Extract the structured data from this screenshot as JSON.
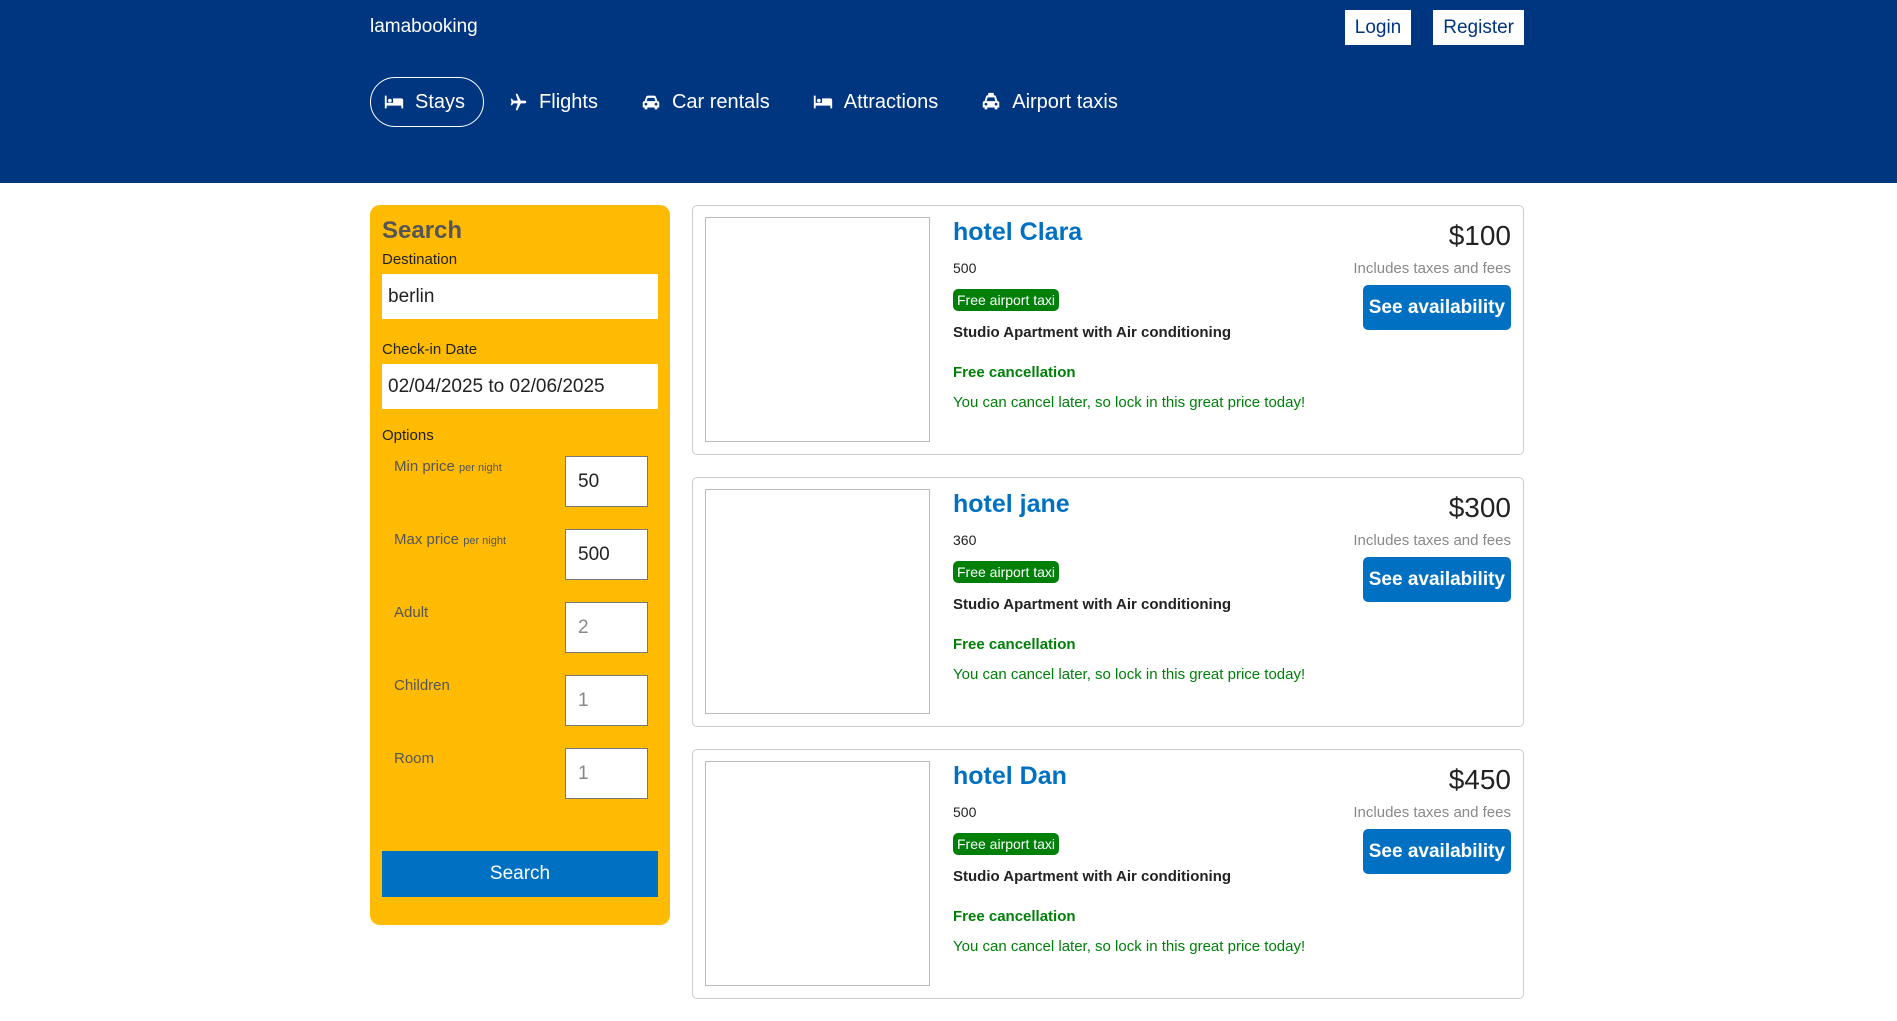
{
  "header": {
    "logo": "lamabooking",
    "login_label": "Login",
    "register_label": "Register",
    "tabs": [
      {
        "label": "Stays",
        "icon": "bed-icon",
        "active": true
      },
      {
        "label": "Flights",
        "icon": "plane-icon",
        "active": false
      },
      {
        "label": "Car rentals",
        "icon": "car-icon",
        "active": false
      },
      {
        "label": "Attractions",
        "icon": "bed-icon",
        "active": false
      },
      {
        "label": "Airport taxis",
        "icon": "taxi-icon",
        "active": false
      }
    ]
  },
  "search": {
    "title": "Search",
    "destination_label": "Destination",
    "destination_value": "berlin",
    "checkin_label": "Check-in Date",
    "checkin_value": "02/04/2025 to 02/06/2025",
    "options_label": "Options",
    "options": {
      "min_price": {
        "label": "Min price",
        "unit": "per night",
        "value": "50"
      },
      "max_price": {
        "label": "Max price",
        "unit": "per night",
        "value": "500"
      },
      "adult": {
        "label": "Adult",
        "placeholder": "2"
      },
      "children": {
        "label": "Children",
        "placeholder": "1"
      },
      "room": {
        "label": "Room",
        "placeholder": "1"
      }
    },
    "button_label": "Search"
  },
  "results": [
    {
      "name": "hotel Clara",
      "distance": "500",
      "taxi_badge": "Free airport taxi",
      "description": "Studio Apartment with Air conditioning",
      "cancel_title": "Free cancellation",
      "cancel_subtitle": "You can cancel later, so lock in this great price today!",
      "price": "$100",
      "tax_note": "Includes taxes and fees",
      "button_label": "See availability"
    },
    {
      "name": "hotel jane",
      "distance": "360",
      "taxi_badge": "Free airport taxi",
      "description": "Studio Apartment with Air conditioning",
      "cancel_title": "Free cancellation",
      "cancel_subtitle": "You can cancel later, so lock in this great price today!",
      "price": "$300",
      "tax_note": "Includes taxes and fees",
      "button_label": "See availability"
    },
    {
      "name": "hotel Dan",
      "distance": "500",
      "taxi_badge": "Free airport taxi",
      "description": "Studio Apartment with Air conditioning",
      "cancel_title": "Free cancellation",
      "cancel_subtitle": "You can cancel later, so lock in this great price today!",
      "price": "$450",
      "tax_note": "Includes taxes and fees",
      "button_label": "See availability"
    }
  ],
  "colors": {
    "header_bg": "#003580",
    "search_bg": "#febb02",
    "accent_blue": "#0071c2",
    "green": "#008009"
  }
}
